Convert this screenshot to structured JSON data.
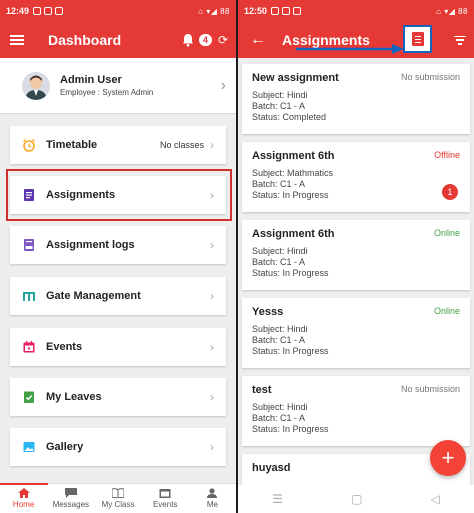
{
  "left": {
    "status_time": "12:49",
    "status_right": "⌂ ▾◢ 88",
    "appbar": {
      "title": "Dashboard",
      "notification_count": "4"
    },
    "profile": {
      "name": "Admin User",
      "role": "Employee : System Admin"
    },
    "menu": [
      {
        "label": "Timetable",
        "value": "No classes",
        "icon": "alarm-clock-icon"
      },
      {
        "label": "Assignments",
        "icon": "assignment-icon"
      },
      {
        "label": "Assignment logs",
        "icon": "log-icon"
      },
      {
        "label": "Gate Management",
        "icon": "gate-icon"
      },
      {
        "label": "Events",
        "icon": "calendar-icon"
      },
      {
        "label": "My Leaves",
        "icon": "check-clipboard-icon"
      },
      {
        "label": "Gallery",
        "icon": "image-icon"
      }
    ],
    "bottom_nav": [
      "Home",
      "Messages",
      "My Class",
      "Events",
      "Me"
    ]
  },
  "right": {
    "status_time": "12:50",
    "status_right": "⌂ ▾◢ 88",
    "appbar": {
      "title": "Assignments"
    },
    "assignments": [
      {
        "title": "New assignment",
        "subject": "Subject: Hindi",
        "batch": "Batch: C1 - A",
        "status": "Status: Completed",
        "badge": "No submission",
        "badge_type": "nosub"
      },
      {
        "title": "Assignment 6th",
        "subject": "Subject: Mathmatics",
        "batch": "Batch: C1 - A",
        "status": "Status: In Progress",
        "badge": "Offline",
        "badge_type": "offline",
        "count": "1"
      },
      {
        "title": "Assignment 6th",
        "subject": "Subject: Hindi",
        "batch": "Batch: C1 - A",
        "status": "Status: In Progress",
        "badge": "Online",
        "badge_type": "online"
      },
      {
        "title": "Yesss",
        "subject": "Subject: Hindi",
        "batch": "Batch: C1 - A",
        "status": "Status: In Progress",
        "badge": "Online",
        "badge_type": "online"
      },
      {
        "title": "test",
        "subject": "Subject: Hindi",
        "batch": "Batch: C1 - A",
        "status": "Status: In Progress",
        "badge": "No submission",
        "badge_type": "nosub"
      },
      {
        "title": "huyasd"
      }
    ],
    "fab_label": "+",
    "system_nav": [
      "☰",
      "▢",
      "◁"
    ]
  },
  "colors": {
    "primary": "#e53935",
    "online": "#43a047",
    "highlight_box": "#1565c0"
  }
}
